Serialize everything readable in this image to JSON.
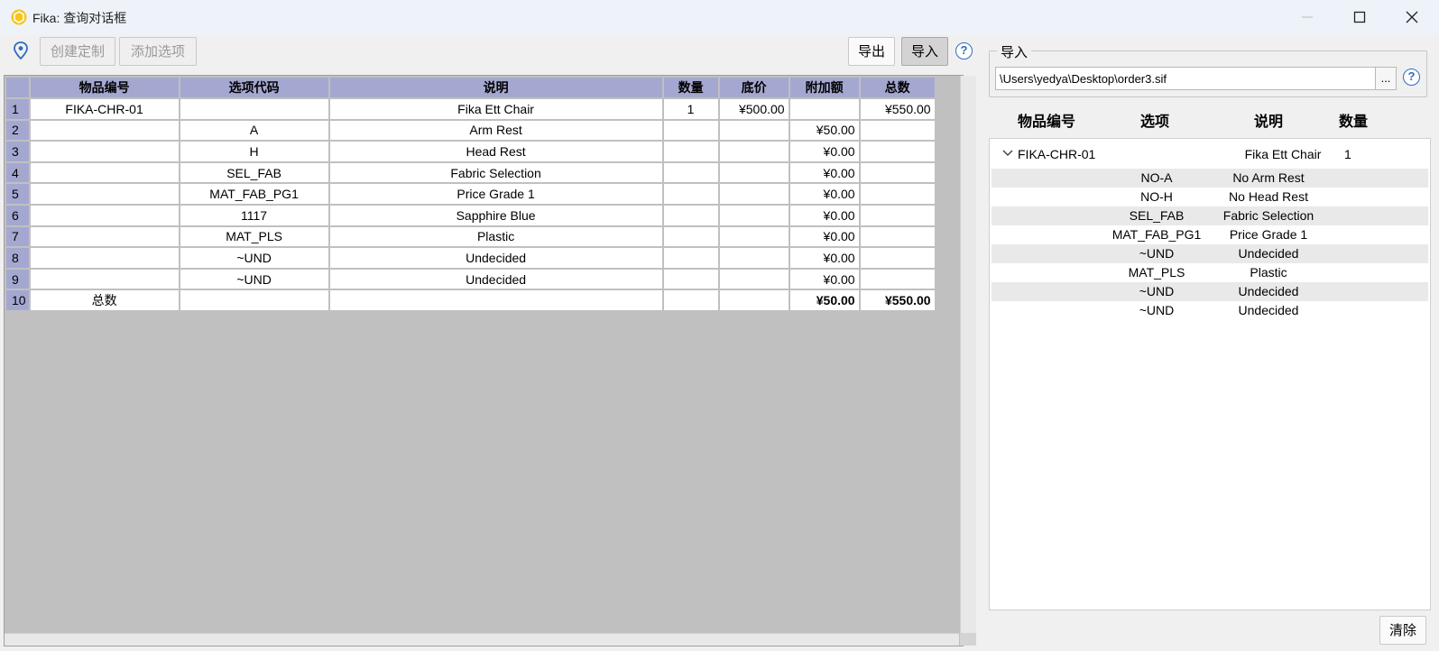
{
  "window": {
    "title": "Fika: 查询对话框"
  },
  "toolbar": {
    "create_custom": "创建定制",
    "add_option": "添加选项",
    "export": "导出",
    "import": "导入",
    "help": "?"
  },
  "grid": {
    "headers": [
      "物品编号",
      "选项代码",
      "说明",
      "数量",
      "底价",
      "附加额",
      "总数"
    ],
    "rows": [
      {
        "n": "1",
        "item": "FIKA-CHR-01",
        "code": "",
        "desc": "Fika Ett Chair",
        "qty": "1",
        "base": "¥500.00",
        "extra": "",
        "total": "¥550.00"
      },
      {
        "n": "2",
        "item": "",
        "code": "A",
        "desc": "Arm Rest",
        "qty": "",
        "base": "",
        "extra": "¥50.00",
        "total": ""
      },
      {
        "n": "3",
        "item": "",
        "code": "H",
        "desc": "Head Rest",
        "qty": "",
        "base": "",
        "extra": "¥0.00",
        "total": ""
      },
      {
        "n": "4",
        "item": "",
        "code": "SEL_FAB",
        "desc": "Fabric Selection",
        "qty": "",
        "base": "",
        "extra": "¥0.00",
        "total": ""
      },
      {
        "n": "5",
        "item": "",
        "code": "MAT_FAB_PG1",
        "desc": "Price Grade 1",
        "qty": "",
        "base": "",
        "extra": "¥0.00",
        "total": ""
      },
      {
        "n": "6",
        "item": "",
        "code": "1117",
        "desc": "Sapphire Blue",
        "qty": "",
        "base": "",
        "extra": "¥0.00",
        "total": ""
      },
      {
        "n": "7",
        "item": "",
        "code": "MAT_PLS",
        "desc": "Plastic",
        "qty": "",
        "base": "",
        "extra": "¥0.00",
        "total": ""
      },
      {
        "n": "8",
        "item": "",
        "code": "~UND",
        "desc": "Undecided",
        "qty": "",
        "base": "",
        "extra": "¥0.00",
        "total": ""
      },
      {
        "n": "9",
        "item": "",
        "code": "~UND",
        "desc": "Undecided",
        "qty": "",
        "base": "",
        "extra": "¥0.00",
        "total": ""
      },
      {
        "n": "10",
        "item": "总数",
        "code": "",
        "desc": "",
        "qty": "",
        "base": "",
        "extra": "¥50.00",
        "total": "¥550.00"
      }
    ]
  },
  "import_panel": {
    "group_label": "导入",
    "path_value": "\\Users\\yedya\\Desktop\\order3.sif",
    "browse_label": "...",
    "help": "?",
    "headers": {
      "item": "物品编号",
      "option": "选项",
      "desc": "说明",
      "qty": "数量"
    },
    "parent": {
      "item": "FIKA-CHR-01",
      "desc": "Fika Ett Chair",
      "qty": "1"
    },
    "children": [
      {
        "code": "NO-A",
        "desc": "No Arm Rest"
      },
      {
        "code": "NO-H",
        "desc": "No Head Rest"
      },
      {
        "code": "SEL_FAB",
        "desc": "Fabric Selection"
      },
      {
        "code": "MAT_FAB_PG1",
        "desc": "Price Grade 1"
      },
      {
        "code": "~UND",
        "desc": "Undecided"
      },
      {
        "code": "MAT_PLS",
        "desc": "Plastic"
      },
      {
        "code": "~UND",
        "desc": "Undecided"
      },
      {
        "code": "~UND",
        "desc": "Undecided"
      }
    ],
    "clear": "清除"
  }
}
